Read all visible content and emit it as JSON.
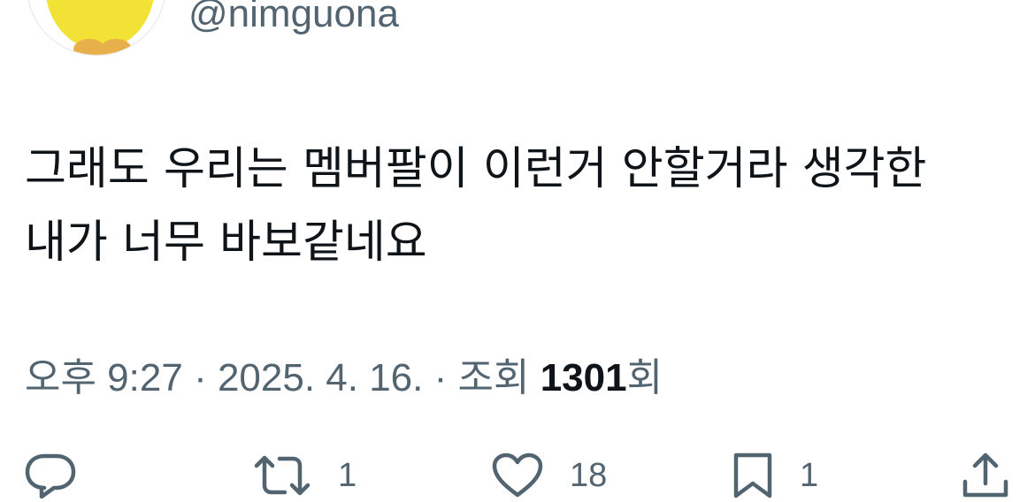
{
  "author": {
    "handle": "@nimguona",
    "avatar_icon": "yellow-duck-avatar"
  },
  "tweet": {
    "text": "그래도 우리는 멤버팔이 이런거 안할거라 생각한 내가 너무 바보같네요"
  },
  "meta": {
    "time": "오후 9:27",
    "separator": "·",
    "date": "2025. 4. 16.",
    "views_label": "조회",
    "views_count": "1301",
    "views_suffix": "회"
  },
  "actions": {
    "reply": {
      "icon": "reply-icon",
      "count": ""
    },
    "retweet": {
      "icon": "retweet-icon",
      "count": "1"
    },
    "like": {
      "icon": "heart-icon",
      "count": "18"
    },
    "bookmark": {
      "icon": "bookmark-icon",
      "count": "1"
    },
    "share": {
      "icon": "share-icon",
      "count": ""
    }
  },
  "colors": {
    "text_primary": "#0f1419",
    "text_secondary": "#536471",
    "avatar_yellow": "#f5e43a"
  }
}
